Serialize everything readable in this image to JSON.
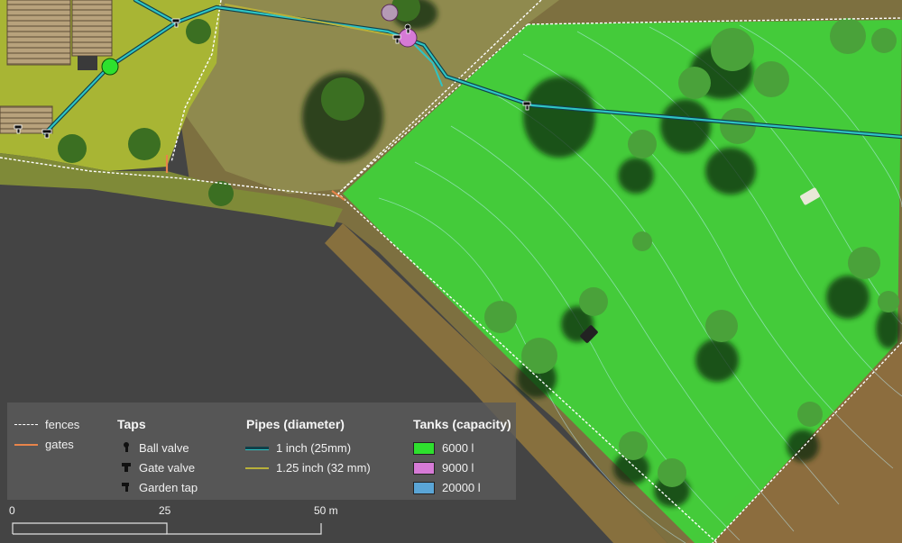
{
  "legend": {
    "fences_label": "fences",
    "gates_label": "gates",
    "taps": {
      "title": "Taps",
      "items": [
        {
          "label": "Ball valve",
          "icon": "ball-valve-icon"
        },
        {
          "label": "Gate valve",
          "icon": "gate-valve-icon"
        },
        {
          "label": "Garden tap",
          "icon": "garden-tap-icon"
        }
      ]
    },
    "pipes": {
      "title": "Pipes (diameter)",
      "items": [
        {
          "label": "1 inch (25mm)",
          "color": "#2ec4c4"
        },
        {
          "label": "1.25 inch (32 mm)",
          "color": "#b8b03a"
        }
      ]
    },
    "tanks": {
      "title": "Tanks (capacity)",
      "items": [
        {
          "label": "6000 l",
          "color": "#2ee02e"
        },
        {
          "label": "9000 l",
          "color": "#d67ad6"
        },
        {
          "label": "20000 l",
          "color": "#5aa5d6"
        }
      ]
    }
  },
  "scalebar": {
    "labels": [
      "0",
      "25",
      "50 m"
    ]
  },
  "colors": {
    "fence": "#ffffff",
    "gate": "#e8844a",
    "paddock_highlight": "#39e03a"
  }
}
